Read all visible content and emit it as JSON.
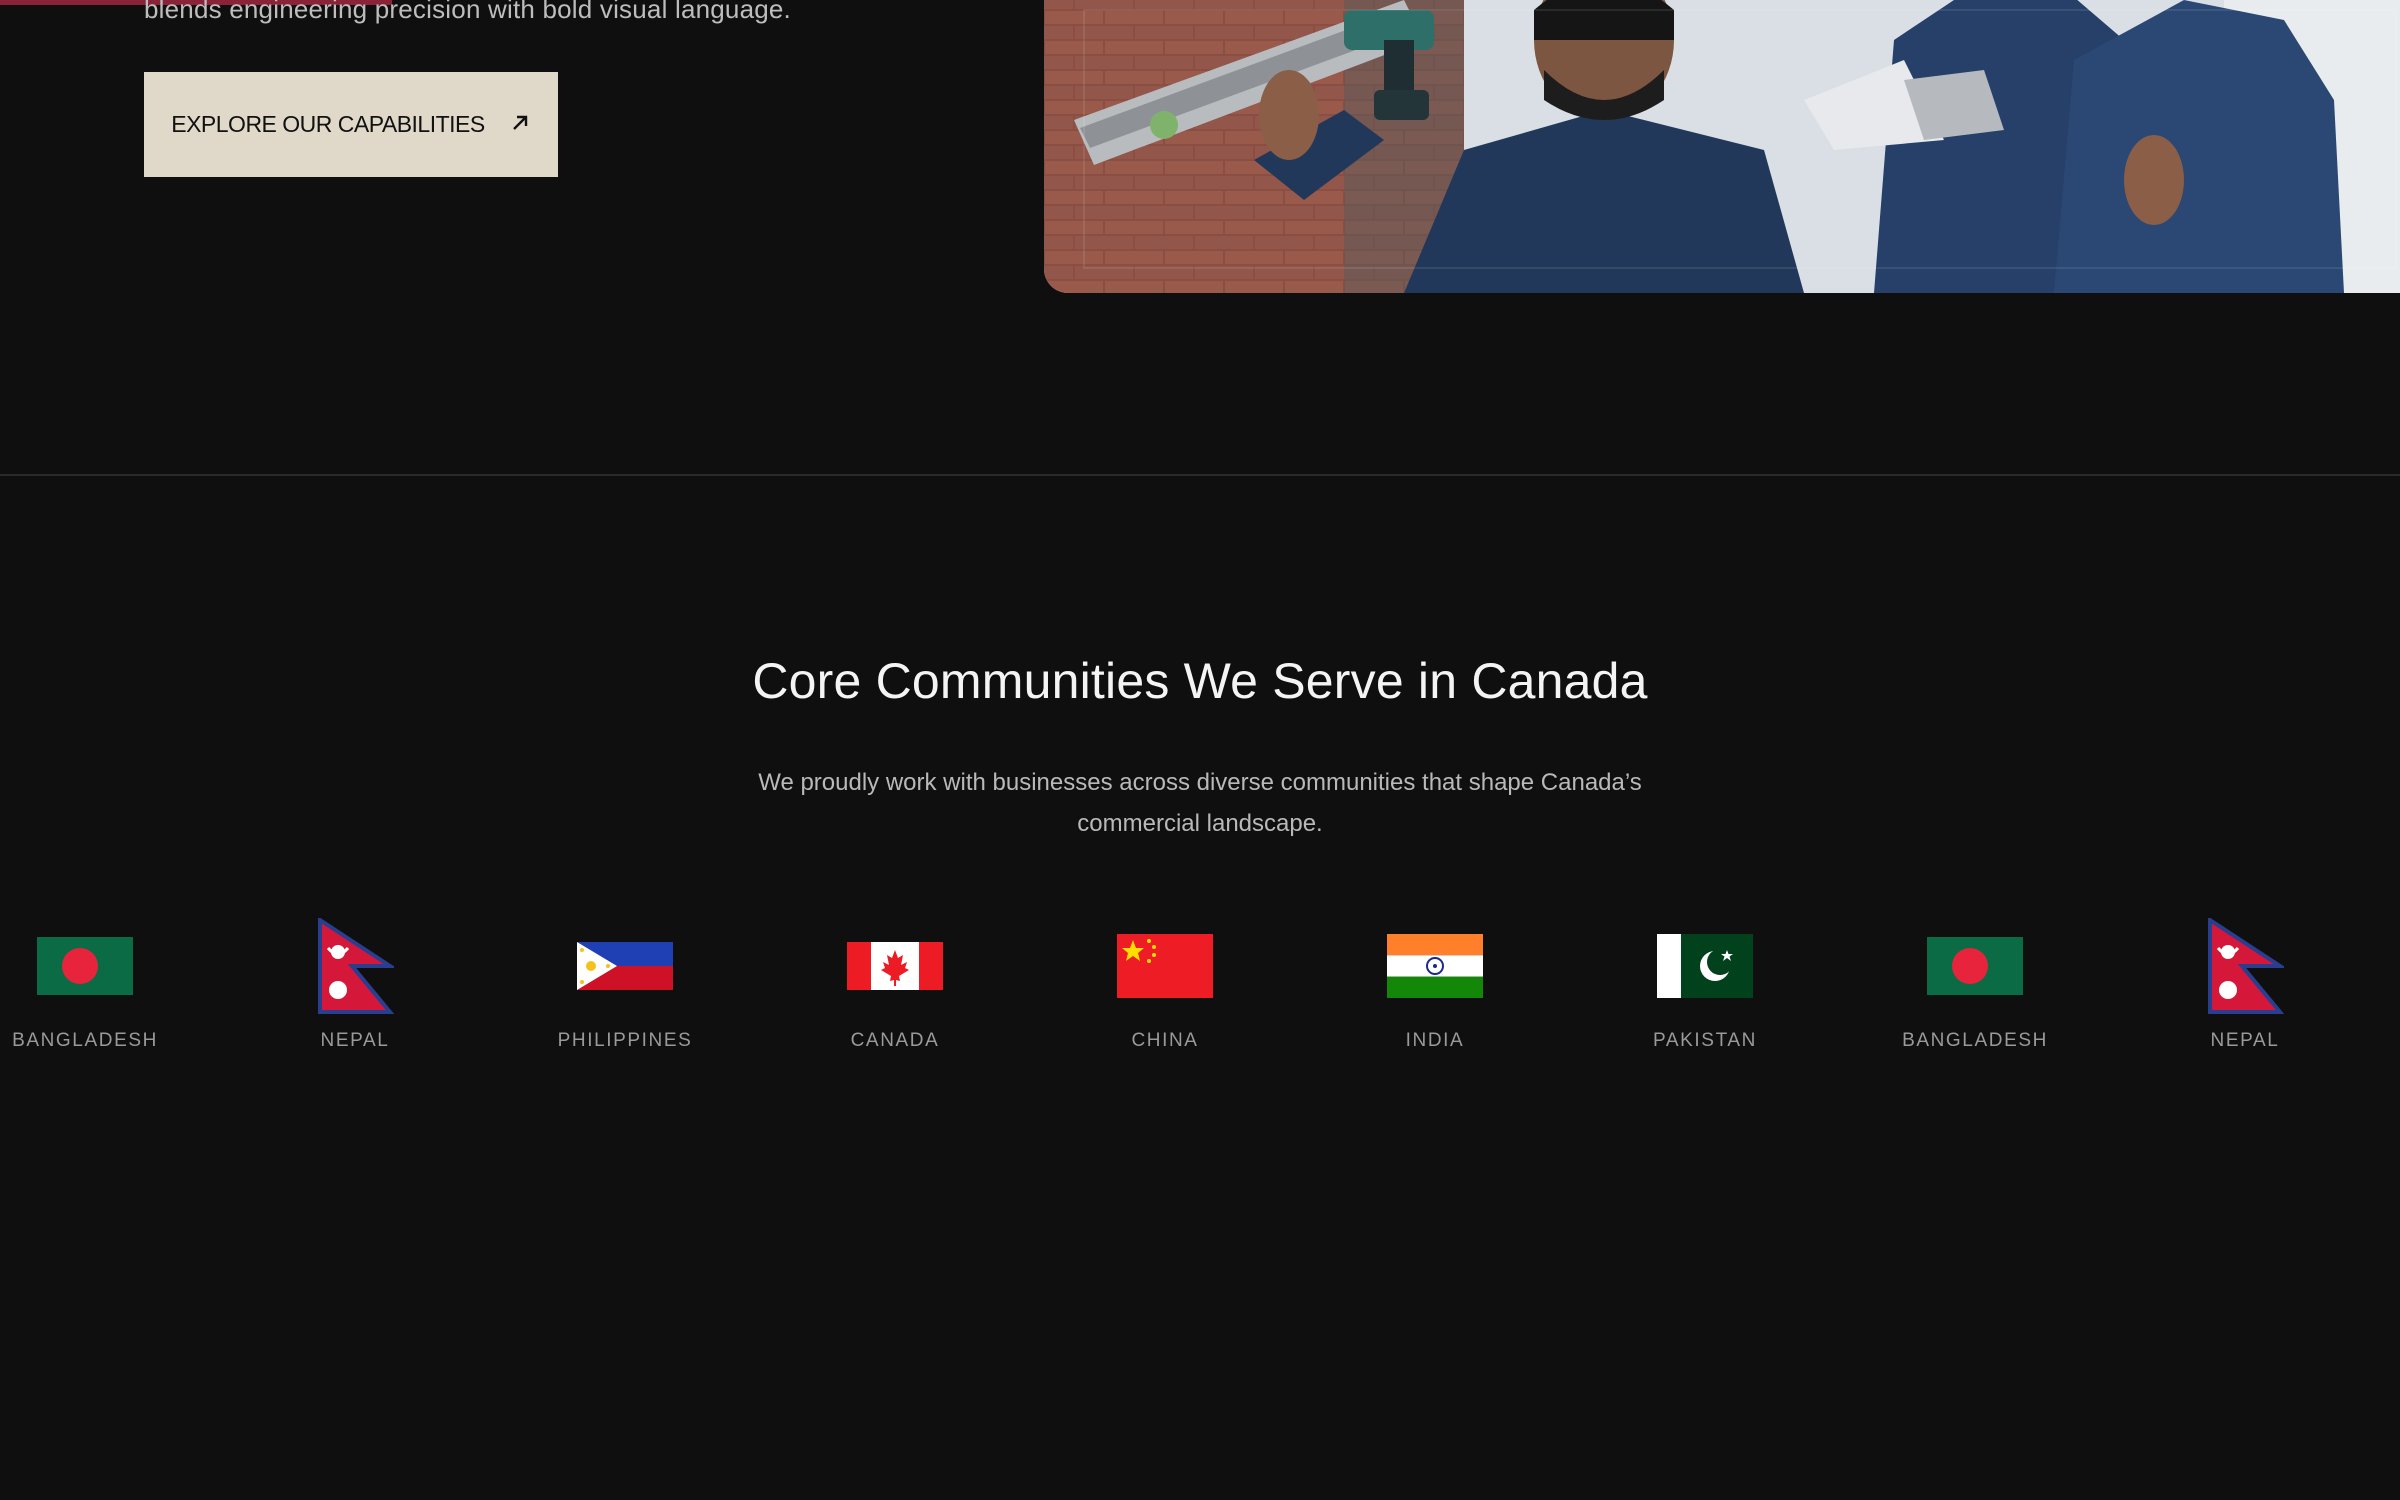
{
  "hero": {
    "text": "blends engineering precision with bold visual language.",
    "cta_label": "EXPLORE OUR CAPABILITIES",
    "cta_icon": "arrow-up-right-icon"
  },
  "communities": {
    "title": "Core Communities We Serve in Canada",
    "subtitle": "We proudly work with businesses across diverse communities that shape Canada’s commercial landscape.",
    "flags": [
      {
        "label": "BANGLADESH",
        "icon": "bangladesh-flag-icon"
      },
      {
        "label": "NEPAL",
        "icon": "nepal-flag-icon"
      },
      {
        "label": "PHILIPPINES",
        "icon": "philippines-flag-icon"
      },
      {
        "label": "CANADA",
        "icon": "canada-flag-icon"
      },
      {
        "label": "CHINA",
        "icon": "china-flag-icon"
      },
      {
        "label": "INDIA",
        "icon": "india-flag-icon"
      },
      {
        "label": "PAKISTAN",
        "icon": "pakistan-flag-icon"
      },
      {
        "label": "BANGLADESH",
        "icon": "bangladesh-flag-icon"
      },
      {
        "label": "NEPAL",
        "icon": "nepal-flag-icon"
      }
    ]
  },
  "colors": {
    "background": "#0f0f0f",
    "accent": "#8a2338",
    "button_bg": "#e0d8c9"
  }
}
